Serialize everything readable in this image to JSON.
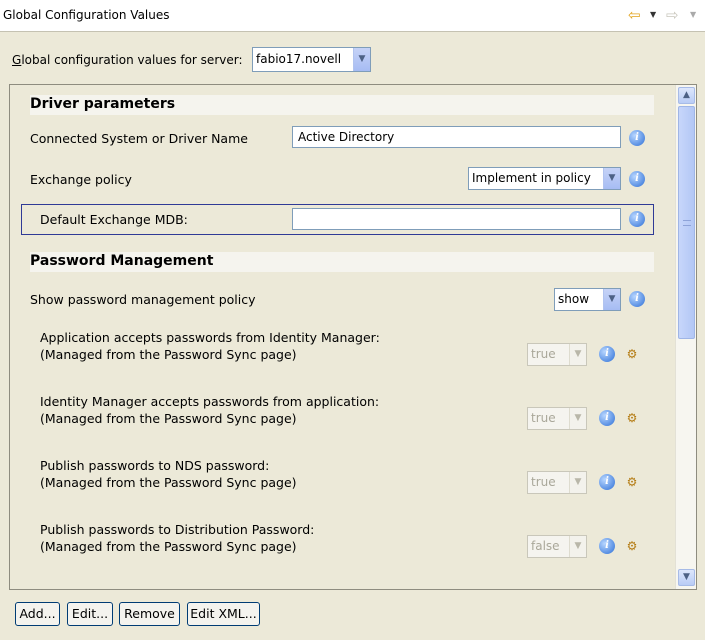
{
  "window": {
    "title": "Global Configuration Values",
    "back_icon": "arrow-left-icon",
    "forward_icon": "arrow-right-icon"
  },
  "server": {
    "label": "Global configuration values for server:",
    "value": "fabio17.novell"
  },
  "driver_parameters": {
    "header": "Driver parameters",
    "connected_system": {
      "label": "Connected System or Driver Name",
      "value": "Active Directory"
    },
    "exchange_policy": {
      "label": "Exchange policy",
      "value": "Implement in policy"
    },
    "default_mdb": {
      "label": "Default Exchange MDB:",
      "value": ""
    }
  },
  "password_management": {
    "header": "Password Management",
    "show_policy": {
      "label": "Show password management policy",
      "value": "show"
    },
    "items": [
      {
        "line1": "Application accepts passwords from Identity Manager:",
        "line2": "(Managed from the Password Sync page)",
        "value": "true"
      },
      {
        "line1": "Identity Manager accepts passwords from application:",
        "line2": "(Managed from the Password Sync page)",
        "value": "true"
      },
      {
        "line1": "Publish passwords to NDS password:",
        "line2": "(Managed from the Password Sync page)",
        "value": "true"
      },
      {
        "line1": "Publish passwords to Distribution Password:",
        "line2": "(Managed from the Password Sync page)",
        "value": "false"
      }
    ]
  },
  "buttons": {
    "add": "Add...",
    "edit": "Edit...",
    "remove": "Remove",
    "edit_xml": "Edit XML..."
  },
  "colors": {
    "background": "#ece9d8",
    "focus_border": "#2f3a96",
    "combo_button": "#a6bcf3"
  }
}
